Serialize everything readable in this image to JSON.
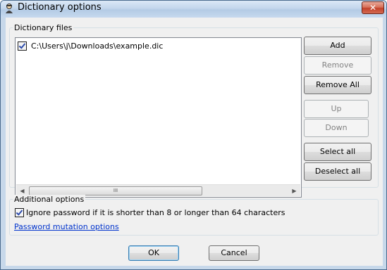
{
  "window": {
    "title": "Dictionary options",
    "close_label": "✕"
  },
  "dictionary_files": {
    "group_label": "Dictionary files",
    "items": [
      {
        "path": "C:\\Users\\j\\Downloads\\example.dic",
        "checked": true
      }
    ],
    "scroll_left": "◀",
    "scroll_right": "▶",
    "scroll_grip": "III"
  },
  "buttons": {
    "add": "Add",
    "remove": "Remove",
    "remove_all": "Remove All",
    "up": "Up",
    "down": "Down",
    "select_all": "Select all",
    "deselect_all": "Deselect all"
  },
  "additional_options": {
    "group_label": "Additional options",
    "ignore_password_label": "Ignore password if it is shorter than 8 or longer than 64 characters",
    "ignore_password_checked": true,
    "mutation_link": "Password mutation options"
  },
  "footer": {
    "ok": "OK",
    "cancel": "Cancel"
  }
}
